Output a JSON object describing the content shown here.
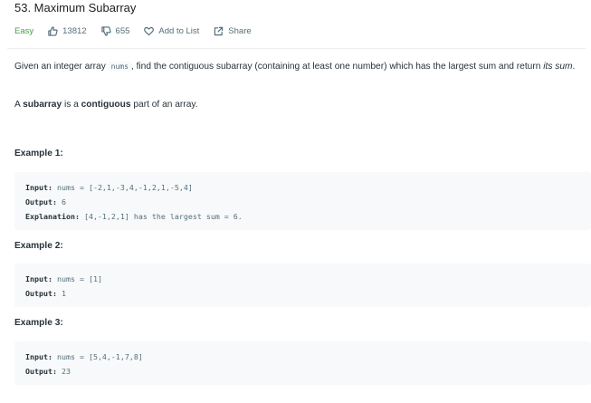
{
  "problem": {
    "title": "53. Maximum Subarray",
    "difficulty": "Easy",
    "likes": "13812",
    "dislikes": "655",
    "add_to_list": "Add to List",
    "share": "Share",
    "colors": {
      "easy": "#43a047",
      "text": "#263238",
      "muted": "#546e7a",
      "code_bg": "#f7f9fa"
    },
    "icons": {
      "like": "thumbs-up-icon",
      "dislike": "thumbs-down-icon",
      "add": "heart-icon",
      "share": "share-icon"
    }
  },
  "description": {
    "p1_a": "Given an integer array ",
    "p1_code": "nums",
    "p1_b": ", find the contiguous subarray (containing at least one number) which has the largest sum and return ",
    "p1_em": "its sum",
    "p1_c": ".",
    "p2_a": "A ",
    "p2_b1": "subarray",
    "p2_c": " is a ",
    "p2_b2": "contiguous",
    "p2_d": " part of an array."
  },
  "examples": [
    {
      "title": "Example 1:",
      "input_label": "Input:",
      "input": "nums = [-2,1,-3,4,-1,2,1,-5,4]",
      "output_label": "Output:",
      "output": "6",
      "explanation_label": "Explanation:",
      "explanation": "[4,-1,2,1] has the largest sum = 6."
    },
    {
      "title": "Example 2:",
      "input_label": "Input:",
      "input": "nums = [1]",
      "output_label": "Output:",
      "output": "1"
    },
    {
      "title": "Example 3:",
      "input_label": "Input:",
      "input": "nums = [5,4,-1,7,8]",
      "output_label": "Output:",
      "output": "23"
    }
  ]
}
